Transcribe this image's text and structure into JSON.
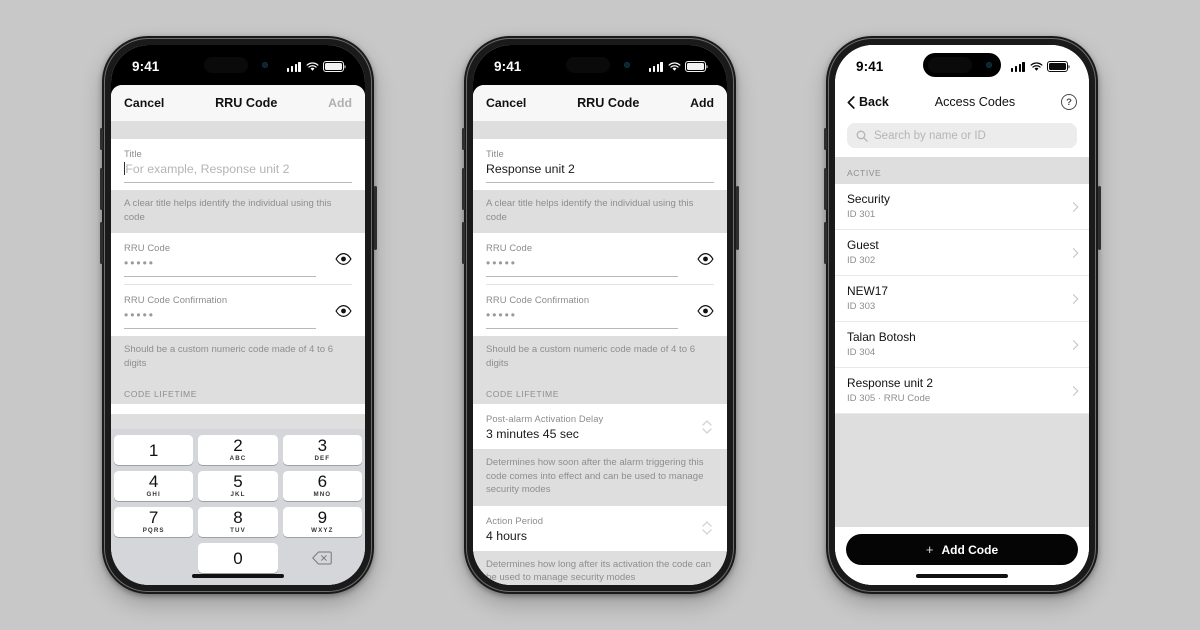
{
  "background_color": "#c8c8c8",
  "phones": [
    {
      "id": "phone-create-code-empty",
      "statusbar": {
        "time": "9:41",
        "theme": "dark"
      },
      "navbar": {
        "cancel": "Cancel",
        "title": "RRU Code",
        "add": "Add",
        "add_enabled": false
      },
      "fields": {
        "title_label": "Title",
        "title_value": "",
        "title_placeholder": "For example, Response unit 2",
        "title_helper": "A clear title helps identify the individual using this code",
        "code_label": "RRU Code",
        "code_value": "•••••",
        "confirm_label": "RRU Code Confirmation",
        "confirm_value": "•••••",
        "code_helper": "Should be a custom numeric code made of 4 to 6 digits",
        "lifetime_section": "CODE LIFETIME"
      },
      "keyboard": {
        "keys": [
          {
            "num": "1",
            "abc": ""
          },
          {
            "num": "2",
            "abc": "ABC"
          },
          {
            "num": "3",
            "abc": "DEF"
          },
          {
            "num": "4",
            "abc": "GHI"
          },
          {
            "num": "5",
            "abc": "JKL"
          },
          {
            "num": "6",
            "abc": "MNO"
          },
          {
            "num": "7",
            "abc": "PQRS"
          },
          {
            "num": "8",
            "abc": "TUV"
          },
          {
            "num": "9",
            "abc": "WXYZ"
          },
          {
            "num": "0",
            "abc": ""
          }
        ],
        "delete_icon": "backspace-icon"
      }
    },
    {
      "id": "phone-create-code-filled",
      "statusbar": {
        "time": "9:41",
        "theme": "dark"
      },
      "navbar": {
        "cancel": "Cancel",
        "title": "RRU Code",
        "add": "Add",
        "add_enabled": true
      },
      "fields": {
        "title_label": "Title",
        "title_value": "Response unit 2",
        "title_helper": "A clear title helps identify the individual using this code",
        "code_label": "RRU Code",
        "code_value": "•••••",
        "confirm_label": "RRU Code Confirmation",
        "confirm_value": "•••••",
        "code_helper": "Should be a custom numeric code made of 4 to 6 digits",
        "lifetime_section": "CODE LIFETIME",
        "delay_label": "Post-alarm Activation Delay",
        "delay_value": "3 minutes 45 sec",
        "delay_helper": "Determines how soon after the alarm triggering this code comes into effect and can be used to manage security modes",
        "period_label": "Action Period",
        "period_value": "4 hours",
        "period_helper": "Determines how long after its activation the code can be used to manage security modes"
      }
    },
    {
      "id": "phone-access-codes-list",
      "statusbar": {
        "time": "9:41",
        "theme": "light"
      },
      "navbar": {
        "back": "Back",
        "title": "Access Codes",
        "help": "?"
      },
      "search": {
        "placeholder": "Search by name or ID"
      },
      "list_section": "ACTIVE",
      "rows": [
        {
          "title": "Security",
          "sub": "ID 301"
        },
        {
          "title": "Guest",
          "sub": "ID 302"
        },
        {
          "title": "NEW17",
          "sub": "ID 303"
        },
        {
          "title": "Talan Botosh",
          "sub": "ID 304"
        },
        {
          "title": "Response unit 2",
          "sub": "ID 305  ·  RRU Code"
        }
      ],
      "cta": {
        "label": "Add Code",
        "icon": "plus-icon"
      }
    }
  ]
}
